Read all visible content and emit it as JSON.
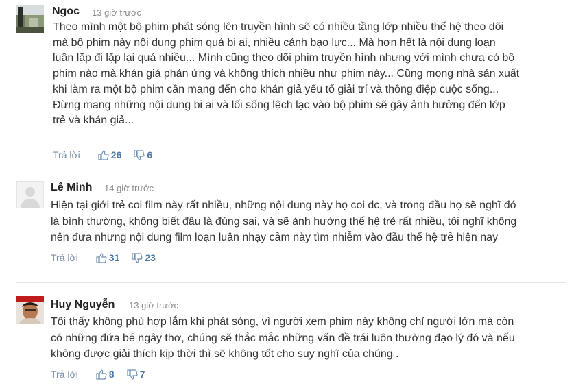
{
  "comments": [
    {
      "author": "Ngoc",
      "time": "13 giờ trước",
      "lines": [
        "Theo mình một bộ phim phát sóng lên truyền hình sẽ có nhiều tầng lớp nhiều thế hệ theo dõi",
        "mà bộ phim này nội dung phim quá bi ai, nhiều cảnh bạo lực... Mà hơn hết là nội dung loạn",
        "luân lặp đi lặp lại quá nhiều... Mình cũng theo dõi phim truyền hình nhưng với mình chưa có bộ",
        "phim nào mà khán giả phản ứng và không thích nhiều như phim này... Cũng mong nhà sản xuất",
        "khi làm ra một bộ phim cần mang đến cho khán giả yếu tố giải trí và thông điệp cuộc sống...",
        "Đừng mang những nội dung bi ai và lối sống lệch lạc vào bộ phim sẽ gây ảnh hưởng đến lớp",
        "trẻ và khán giả..."
      ],
      "reply": "Trả lời",
      "likes": "26",
      "dislikes": "6"
    },
    {
      "author": "Lê Minh",
      "time": "14 giờ trước",
      "lines": [
        "Hiện tại giới trẻ coi film này rất nhiều, những nội dung này họ coi dc, và trong đầu họ sẽ nghĩ đó",
        "là bình thường, không biết đâu là đúng sai, và sẽ ảnh hưởng thế hệ trẻ rất nhiều, tôi nghĩ không",
        "nên đưa nhưng nội dung film loạn luân nhạy cảm này tìm nhiễm vào đầu thế hệ trẻ hiện nay"
      ],
      "reply": "Trả lời",
      "likes": "31",
      "dislikes": "23"
    },
    {
      "author": "Huy Nguyễn",
      "time": "13 giờ trước",
      "lines": [
        "Tôi thấy không phù hợp lắm khi phát sóng, vì người xem phim này không chỉ người lớn mà còn",
        "có những đứa bé ngây thơ, chúng sẽ thắc mắc những vấn đề trái luôn thường đạo lý đó và nếu",
        "không được giải thích kịp thời thì sẽ không tốt cho suy nghĩ của chúng ."
      ],
      "reply": "Trả lời",
      "likes": "8",
      "dislikes": "7"
    }
  ],
  "icons": {
    "like": "thumbs-up-icon",
    "dislike": "thumbs-down-icon"
  },
  "colors": {
    "link": "#5e88b0",
    "count": "#4d79a6",
    "timestamp": "#8a8a8a"
  }
}
